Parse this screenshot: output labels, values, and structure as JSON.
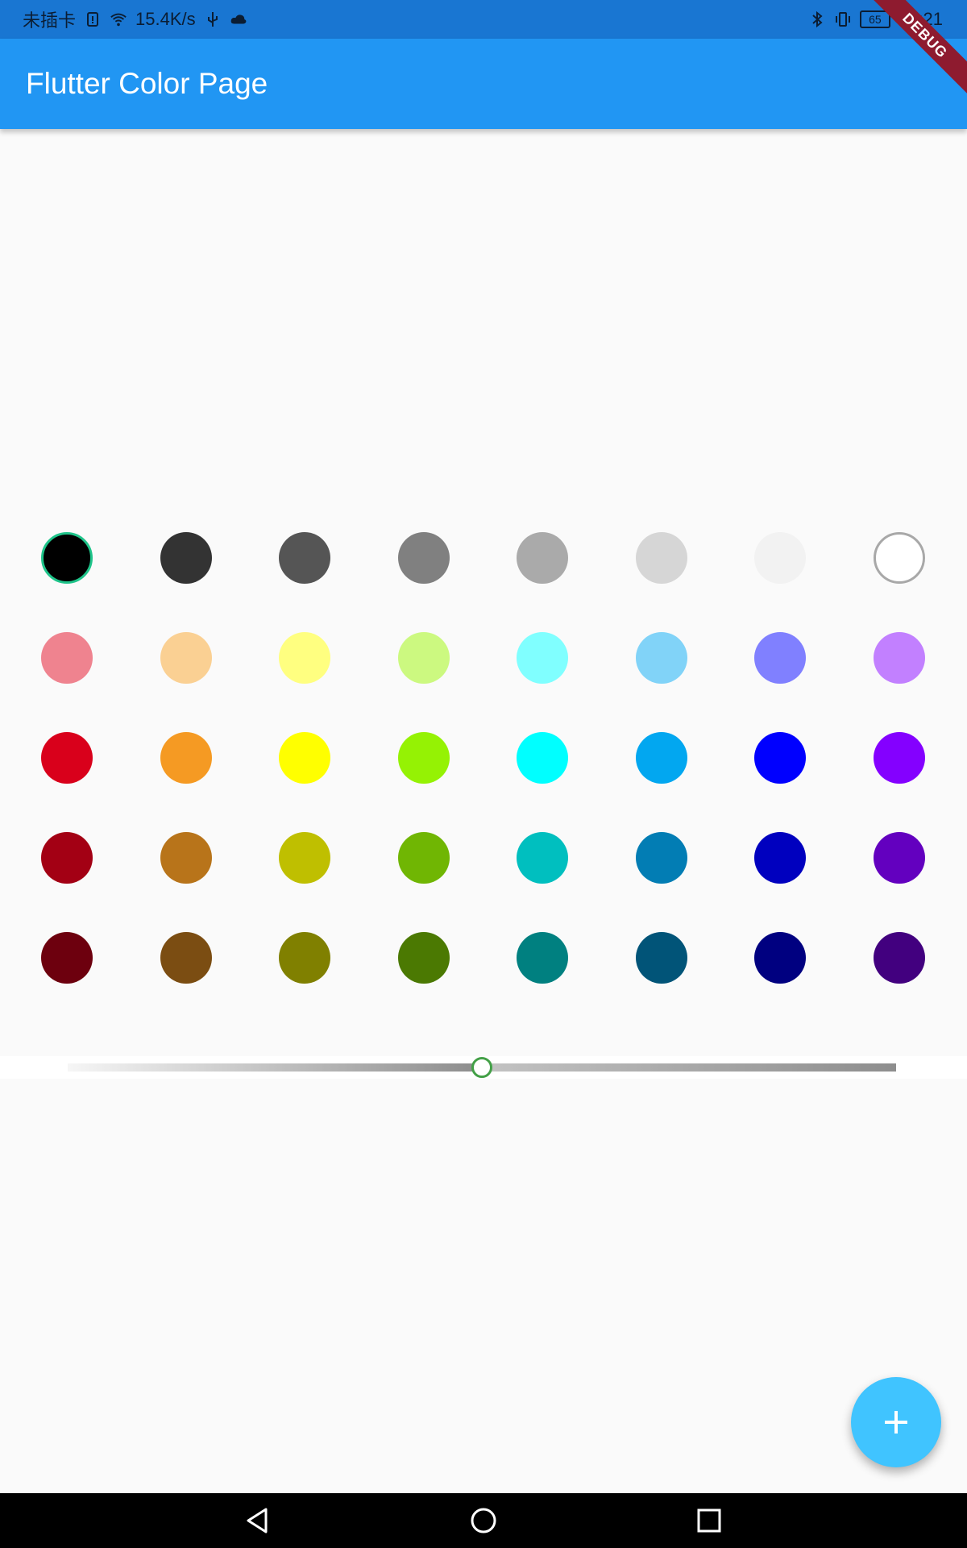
{
  "status_bar": {
    "carrier": "未插卡",
    "speed": "15.4K/s",
    "battery": "65",
    "time": "14:21"
  },
  "app_bar": {
    "title": "Flutter Color Page"
  },
  "debug_banner": "DEBUG",
  "colors": {
    "app_bar": "#2196f3",
    "status_bar": "#1976d2",
    "fab": "#40c4ff",
    "selected_ring": "#1fc48a",
    "slider_thumb": "#43a047"
  },
  "palette": [
    [
      "#000000",
      "#333333",
      "#555555",
      "#808080",
      "#aaaaaa",
      "#d6d6d6",
      "#f2f2f2",
      "#ffffff"
    ],
    [
      "#ef838f",
      "#fad093",
      "#ffff80",
      "#ccf980",
      "#80ffff",
      "#81d3f8",
      "#8080ff",
      "#c280ff"
    ],
    [
      "#d9001b",
      "#f59a23",
      "#ffff00",
      "#95f204",
      "#00ffff",
      "#02a7f0",
      "#0000ff",
      "#8400ff"
    ],
    [
      "#a30014",
      "#b8741a",
      "#bfbf00",
      "#70b603",
      "#00bfbf",
      "#027db4",
      "#0000bf",
      "#6300bf"
    ],
    [
      "#6d000e",
      "#7b4d12",
      "#808000",
      "#4b7902",
      "#008080",
      "#015478",
      "#000080",
      "#42007f"
    ]
  ],
  "selected_color": "#000000",
  "slider": {
    "value": 0.5
  },
  "fab": {
    "icon": "plus-icon"
  }
}
